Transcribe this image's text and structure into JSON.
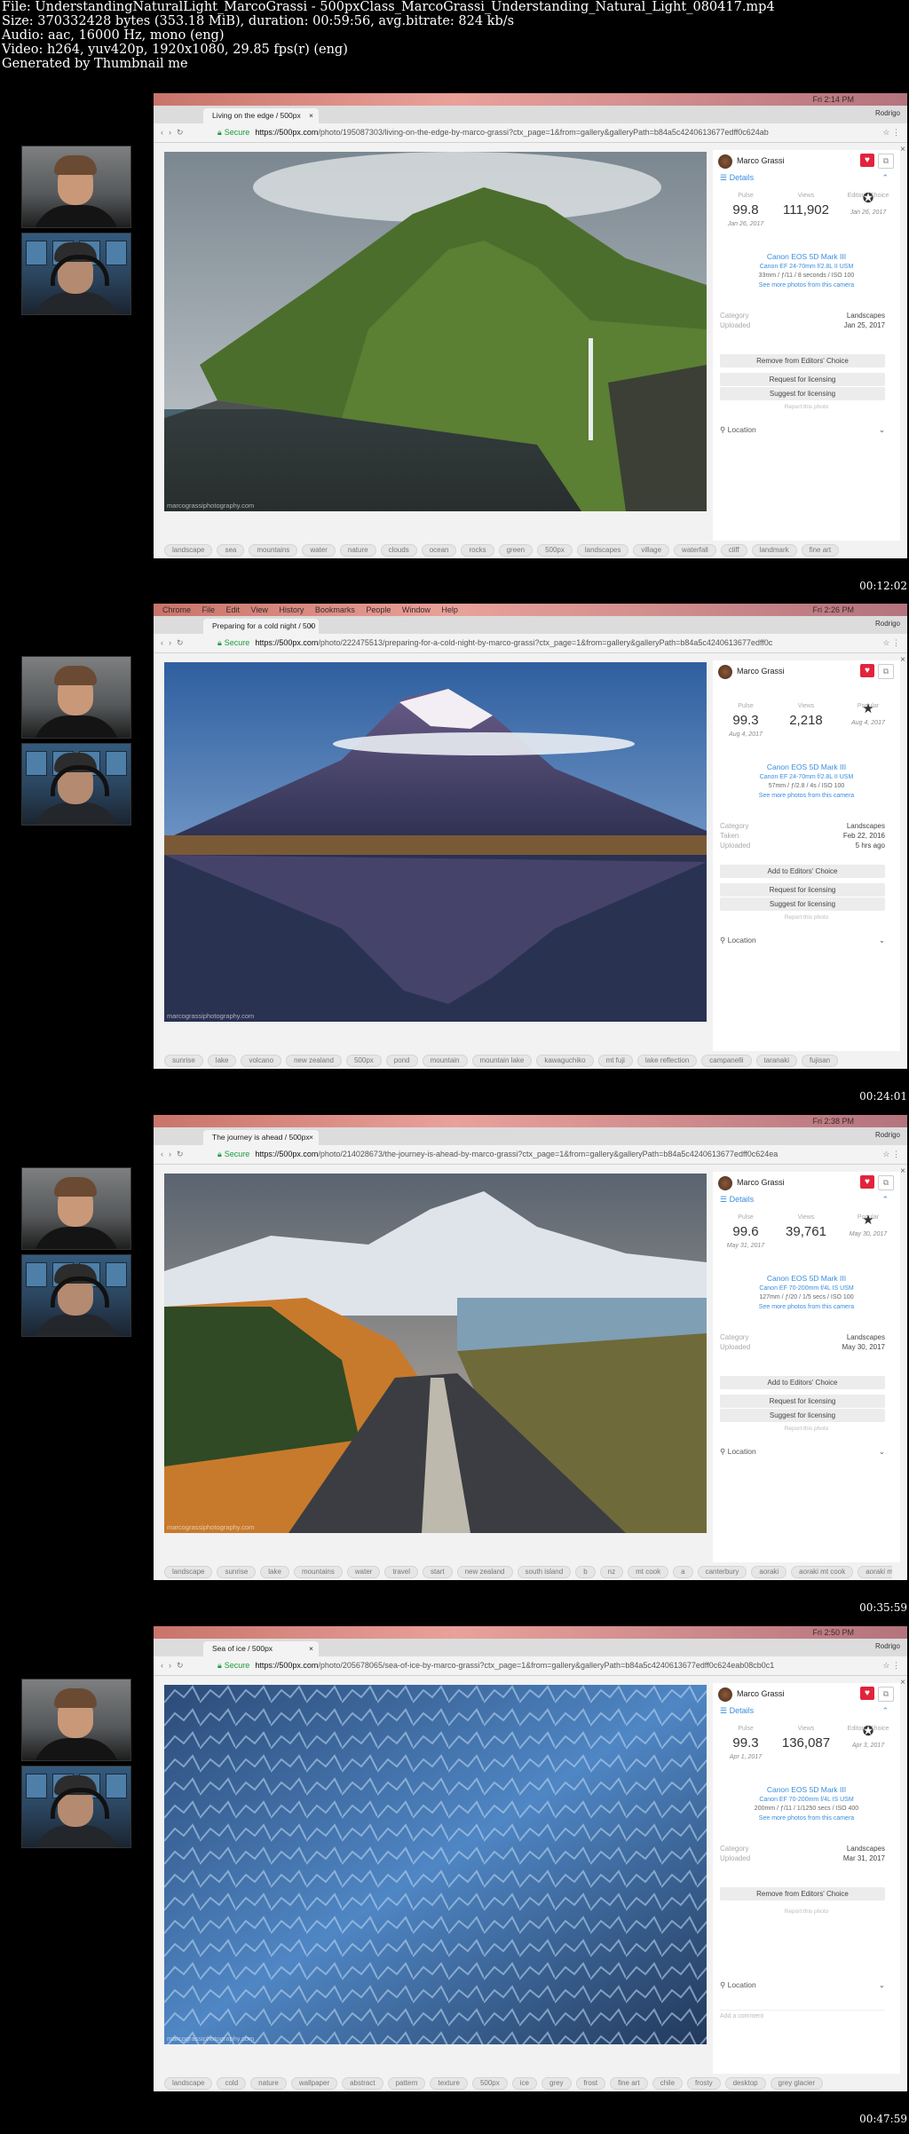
{
  "header": {
    "line1": "File: UnderstandingNaturalLight_MarcoGrassi - 500pxClass_MarcoGrassi_Understanding_Natural_Light_080417.mp4",
    "line2": "Size: 370332428 bytes (353.18 MiB), duration: 00:59:56, avg.bitrate: 824 kb/s",
    "line3": "Audio: aac, 16000 Hz, mono (eng)",
    "line4": "Video: h264, yuv420p, 1920x1080, 29.85 fps(r) (eng)",
    "line5": "Generated by Thumbnail me"
  },
  "frames": [
    {
      "timestamp": "00:12:02",
      "clock": "Fri 2:14 PM",
      "menu": "",
      "tab_title": "Living on the edge / 500px",
      "user": "Rodrigo",
      "secure": "Secure",
      "url_host": "https://500px.com",
      "url_path": "/photo/195087303/living-on-the-edge-by-marco-grassi?ctx_page=1&from=gallery&galleryPath=b84a5c4240613677edff0c624ab",
      "photo_kind": "cliff",
      "watermark": "marcograssiphotography.com",
      "author": "Marco Grassi",
      "details_label": "Details",
      "stats": [
        {
          "key": "Pulse",
          "value": "99.8",
          "date": "Jan 26, 2017"
        },
        {
          "key": "Views",
          "value": "111,902",
          "date": ""
        },
        {
          "key": "Editors' Choice",
          "value": "",
          "date": "Jan 26, 2017",
          "icon": "award"
        }
      ],
      "camera": {
        "model": "Canon EOS 5D Mark III",
        "lens": "Canon EF 24-70mm f/2.8L II USM",
        "exif": "33mm / ƒ/11 / 8 seconds / ISO 100",
        "more": "See more photos from this camera"
      },
      "meta": [
        {
          "label": "Category",
          "value": "Landscapes"
        },
        {
          "label": "Uploaded",
          "value": "Jan 25, 2017"
        }
      ],
      "buttons": [
        "Remove from Editors' Choice",
        "Request for licensing",
        "Suggest for licensing"
      ],
      "report": "Report this photo",
      "location": "Location",
      "comment": "",
      "tags": [
        "landscape",
        "sea",
        "mountains",
        "water",
        "nature",
        "clouds",
        "ocean",
        "rocks",
        "green",
        "500px",
        "landscapes",
        "village",
        "waterfall",
        "cliff",
        "landmark",
        "fine art"
      ]
    },
    {
      "timestamp": "00:24:01",
      "clock": "Fri 2:26 PM",
      "menu": "Chrome  File  Edit  View  History  Bookmarks  People  Window  Help",
      "tab_title": "Preparing for a cold night / 500",
      "user": "Rodrigo",
      "secure": "Secure",
      "url_host": "https://500px.com",
      "url_path": "/photo/222475513/preparing-for-a-cold-night-by-marco-grassi?ctx_page=1&from=gallery&galleryPath=b84a5c4240613677edff0c",
      "photo_kind": "volcano",
      "watermark": "marcograssiphotography.com",
      "author": "Marco Grassi",
      "details_label": "",
      "stats": [
        {
          "key": "Pulse",
          "value": "99.3",
          "date": "Aug 4, 2017"
        },
        {
          "key": "Views",
          "value": "2,218",
          "date": ""
        },
        {
          "key": "Popular",
          "value": "",
          "date": "Aug 4, 2017",
          "icon": "star"
        }
      ],
      "camera": {
        "model": "Canon EOS 5D Mark III",
        "lens": "Canon EF 24-70mm f/2.8L II USM",
        "exif": "57mm / ƒ/2.8 / 4s / ISO 100",
        "more": "See more photos from this camera"
      },
      "meta": [
        {
          "label": "Category",
          "value": "Landscapes"
        },
        {
          "label": "Taken",
          "value": "Feb 22, 2016"
        },
        {
          "label": "Uploaded",
          "value": "5 hrs ago"
        }
      ],
      "buttons": [
        "Add to Editors' Choice",
        "Request for licensing",
        "Suggest for licensing"
      ],
      "report": "Report this photo",
      "location": "Location",
      "comment": "",
      "tags": [
        "sunrise",
        "lake",
        "volcano",
        "new zealand",
        "500px",
        "pond",
        "mountain",
        "mountain lake",
        "kawaguchiko",
        "mt fuji",
        "lake reflection",
        "campanelli",
        "taranaki",
        "fujisan"
      ]
    },
    {
      "timestamp": "00:35:59",
      "clock": "Fri 2:38 PM",
      "menu": "",
      "tab_title": "The journey is ahead / 500px",
      "user": "Rodrigo",
      "secure": "Secure",
      "url_host": "https://500px.com",
      "url_path": "/photo/214028673/the-journey-is-ahead-by-marco-grassi?ctx_page=1&from=gallery&galleryPath=b84a5c4240613677edff0c624ea",
      "photo_kind": "road",
      "watermark": "marcograssiphotography.com",
      "author": "Marco Grassi",
      "details_label": "Details",
      "stats": [
        {
          "key": "Pulse",
          "value": "99.6",
          "date": "May 31, 2017"
        },
        {
          "key": "Views",
          "value": "39,761",
          "date": ""
        },
        {
          "key": "Popular",
          "value": "",
          "date": "May 30, 2017",
          "icon": "star"
        }
      ],
      "camera": {
        "model": "Canon EOS 5D Mark III",
        "lens": "Canon EF 70-200mm f/4L IS USM",
        "exif": "127mm / ƒ/20 / 1/5 secs / ISO 100",
        "more": "See more photos from this camera"
      },
      "meta": [
        {
          "label": "Category",
          "value": "Landscapes"
        },
        {
          "label": "Uploaded",
          "value": "May 30, 2017"
        }
      ],
      "buttons": [
        "Add to Editors' Choice",
        "Request for licensing",
        "Suggest for licensing"
      ],
      "report": "Report this photo",
      "location": "Location",
      "comment": "",
      "tags": [
        "landscape",
        "sunrise",
        "lake",
        "mountains",
        "water",
        "travel",
        "start",
        "new zealand",
        "south island",
        "b",
        "nz",
        "mt cook",
        "a",
        "canterbury",
        "aoraki",
        "aoraki mt cook",
        "aoraki mt"
      ]
    },
    {
      "timestamp": "00:47:59",
      "clock": "Fri 2:50 PM",
      "menu": "",
      "tab_title": "Sea of ice / 500px",
      "user": "Rodrigo",
      "secure": "Secure",
      "url_host": "https://500px.com",
      "url_path": "/photo/205678065/sea-of-ice-by-marco-grassi?ctx_page=1&from=gallery&galleryPath=b84a5c4240613677edff0c624eab08cb0c1",
      "photo_kind": "ice",
      "watermark": "marcograssiphotography.com",
      "author": "Marco Grassi",
      "details_label": "Details",
      "stats": [
        {
          "key": "Pulse",
          "value": "99.3",
          "date": "Apr 1, 2017"
        },
        {
          "key": "Views",
          "value": "136,087",
          "date": ""
        },
        {
          "key": "Editors' Choice",
          "value": "",
          "date": "Apr 3, 2017",
          "icon": "award"
        }
      ],
      "camera": {
        "model": "Canon EOS 5D Mark III",
        "lens": "Canon EF 70-200mm f/4L IS USM",
        "exif": "200mm / ƒ/11 / 1/1250 secs / ISO 400",
        "more": "See more photos from this camera"
      },
      "meta": [
        {
          "label": "Category",
          "value": "Landscapes"
        },
        {
          "label": "Uploaded",
          "value": "Mar 31, 2017"
        }
      ],
      "buttons": [
        "Remove from Editors' Choice"
      ],
      "report": "Report this photo",
      "location": "Location",
      "comment": "Add a comment",
      "tags": [
        "landscape",
        "cold",
        "nature",
        "wallpaper",
        "abstract",
        "pattern",
        "texture",
        "500px",
        "ice",
        "grey",
        "frost",
        "fine art",
        "chile",
        "frosty",
        "desktop",
        "grey glacier"
      ]
    }
  ]
}
